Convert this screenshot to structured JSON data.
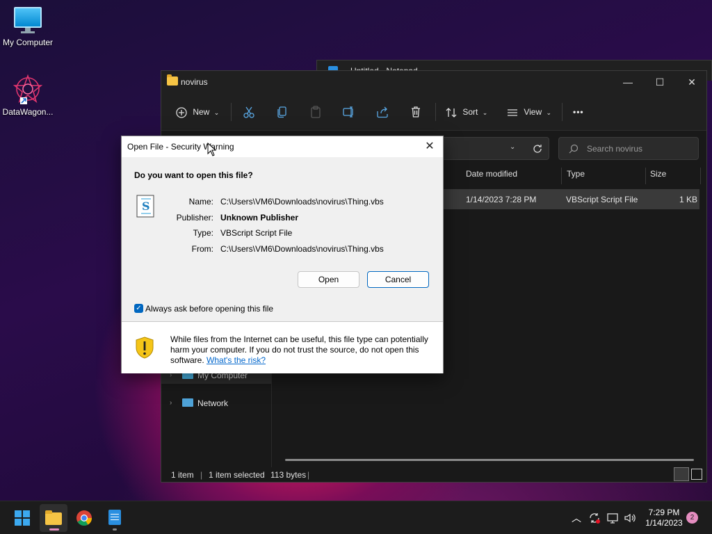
{
  "desktop": {
    "icons": [
      {
        "label": "My Computer"
      },
      {
        "label": "DataWagon..."
      }
    ]
  },
  "notepad": {
    "title": "Untitled - Notepad"
  },
  "explorer": {
    "title": "novirus",
    "window_controls": {
      "minimize": "—",
      "maximize": "☐",
      "close": "✕"
    },
    "toolbar": {
      "new_label": "New",
      "sort_label": "Sort",
      "view_label": "View",
      "more_label": "•••"
    },
    "search_placeholder": "Search novirus",
    "columns": [
      "Date modified",
      "Type",
      "Size"
    ],
    "files": [
      {
        "date": "1/14/2023 7:28 PM",
        "type": "VBScript Script File",
        "size": "1 KB"
      }
    ],
    "nav": [
      {
        "label": "My Computer"
      },
      {
        "label": "Network"
      }
    ],
    "status": {
      "items": "1 item",
      "selected": "1 item selected",
      "bytes": "113 bytes",
      "divider": "|"
    }
  },
  "dialog": {
    "title": "Open File - Security Warning",
    "question": "Do you want to open this file?",
    "fields": [
      {
        "key": "Name:",
        "value": "C:\\Users\\VM6\\Downloads\\novirus\\Thing.vbs"
      },
      {
        "key": "Publisher:",
        "value": "Unknown Publisher"
      },
      {
        "key": "Type:",
        "value": "VBScript Script File"
      },
      {
        "key": "From:",
        "value": "C:\\Users\\VM6\\Downloads\\novirus\\Thing.vbs"
      }
    ],
    "open_button": "Open",
    "cancel_button": "Cancel",
    "checkbox_label": "Always ask before opening this file",
    "checkbox_checked": true,
    "warning_text": "While files from the Internet can be useful, this file type can potentially harm your computer. If you do not trust the source, do not open this software.",
    "risk_link": "What's the risk?"
  },
  "taskbar": {
    "time": "7:29 PM",
    "date": "1/14/2023",
    "notification_count": "2"
  },
  "colors": {
    "accent": "#0067c0",
    "explorer_bg": "#191919",
    "dialog_bg": "#f0f0f0",
    "taskbar_bg": "#1c1c1c"
  }
}
